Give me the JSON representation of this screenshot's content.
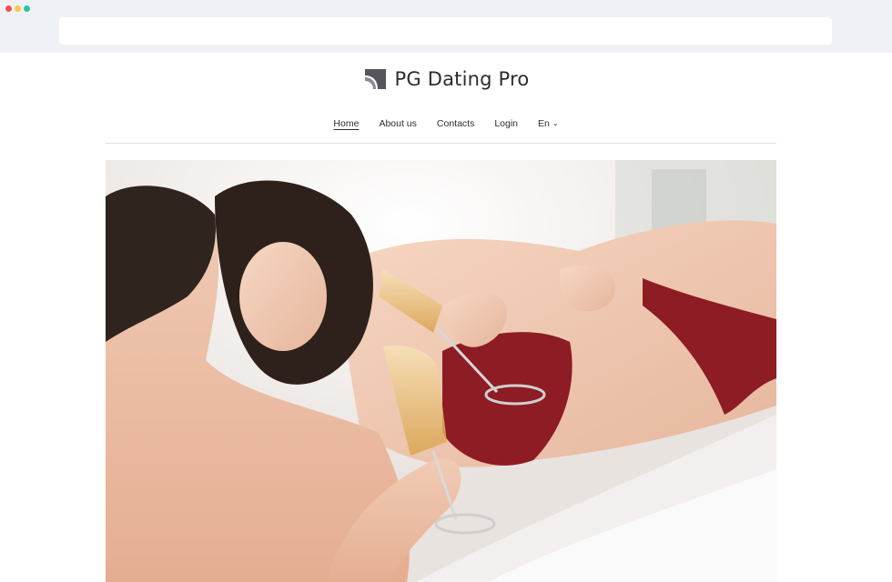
{
  "browser": {
    "traffic_lights": [
      "close",
      "minimize",
      "zoom"
    ],
    "address_value": ""
  },
  "site": {
    "logo_text": "PG Dating Pro"
  },
  "nav": {
    "items": [
      {
        "label": "Home",
        "active": true
      },
      {
        "label": "About us",
        "active": false
      },
      {
        "label": "Contacts",
        "active": false
      },
      {
        "label": "Login",
        "active": false
      }
    ],
    "language": "En",
    "language_icon": "chevron-down-icon"
  },
  "hero": {
    "image_alt": "couple-with-champagne-photo"
  },
  "colors": {
    "window_background": "#eef2f6",
    "page_background": "#ffffff",
    "text_dark": "#2b2b33",
    "lingerie_red": "#8e1c24",
    "traffic_red": "#f2504b",
    "traffic_yellow": "#f7c948",
    "traffic_green": "#2fc3a3"
  }
}
